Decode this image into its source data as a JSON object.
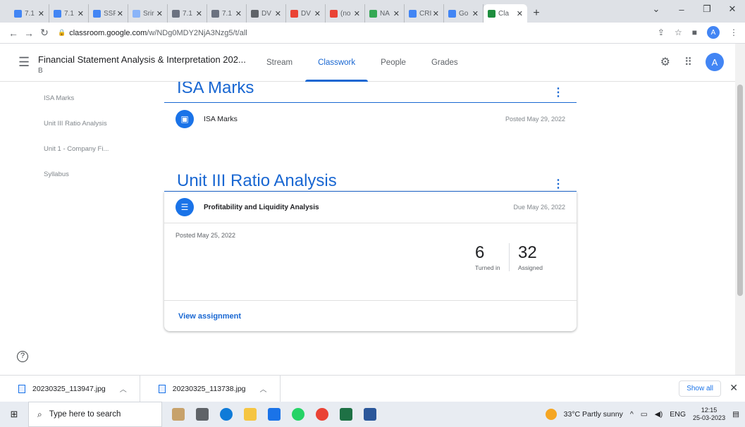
{
  "browser": {
    "tabs": [
      {
        "label": "7.1",
        "color": "#4285f4"
      },
      {
        "label": "7.1",
        "color": "#4285f4"
      },
      {
        "label": "SSF",
        "color": "#4285f4"
      },
      {
        "label": "Srir",
        "color": "#8ab4f8"
      },
      {
        "label": "7.1",
        "color": "#6b7280"
      },
      {
        "label": "7.1",
        "color": "#6b7280"
      },
      {
        "label": "DV",
        "color": "#5f6368"
      },
      {
        "label": "DV",
        "color": "#ea4335"
      },
      {
        "label": "(no",
        "color": "#ea4335"
      },
      {
        "label": "NA",
        "color": "#34a853"
      },
      {
        "label": "CRI",
        "color": "#4285f4"
      },
      {
        "label": "Go",
        "color": "#4285f4"
      },
      {
        "label": "Cla",
        "color": "#1e8e3e"
      }
    ],
    "new_tab": "+",
    "url_domain": "classroom.google.com",
    "url_path": "/w/NDg0MDY2NjA3Nzg5/t/all",
    "profile_initial": "A"
  },
  "header": {
    "course_title": "Financial Statement Analysis & Interpretation 202...",
    "course_section": "B",
    "tabs": [
      "Stream",
      "Classwork",
      "People",
      "Grades"
    ],
    "active_tab": "Classwork",
    "avatar_initial": "A"
  },
  "topics": [
    "ISA Marks",
    "Unit III Ratio Analysis",
    "Unit 1 - Company Fi...",
    "Syllabus"
  ],
  "sections": {
    "isa": {
      "heading": "ISA Marks",
      "item_title": "ISA Marks",
      "item_meta": "Posted May 29, 2022"
    },
    "ratio": {
      "heading": "Unit III Ratio Analysis",
      "item_title": "Profitability and Liquidity Analysis",
      "item_meta": "Due May 26, 2022",
      "posted": "Posted May 25, 2022",
      "turned_in_count": "6",
      "turned_in_label": "Turned in",
      "assigned_count": "32",
      "assigned_label": "Assigned",
      "view_link": "View assignment"
    }
  },
  "downloads": {
    "files": [
      "20230325_113947.jpg",
      "20230325_113738.jpg"
    ],
    "show_all": "Show all"
  },
  "taskbar": {
    "search_placeholder": "Type here to search",
    "weather": "33°C  Partly sunny",
    "lang": "ENG",
    "time": "12:15",
    "date": "25-03-2023"
  },
  "colors": {
    "accent": "#1967d2",
    "icon_blue": "#1a73e8"
  }
}
